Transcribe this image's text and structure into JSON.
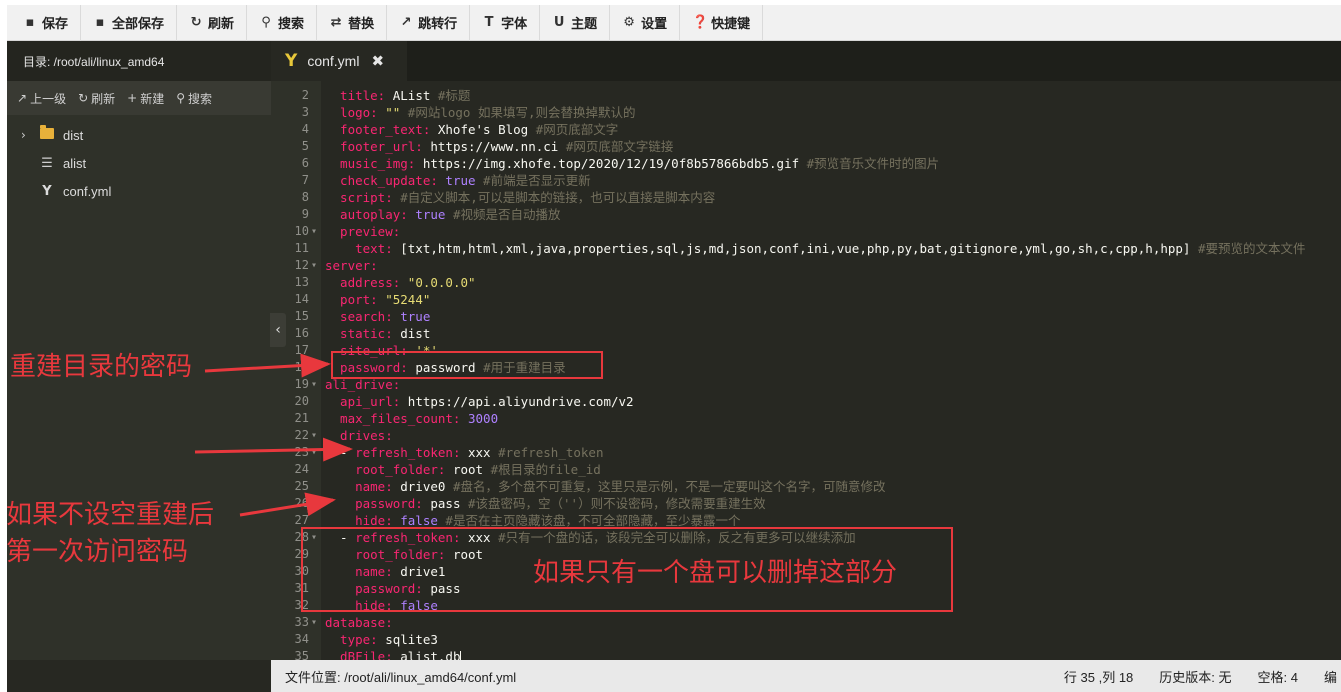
{
  "toolbar": {
    "buttons": [
      {
        "icon": "save-icon",
        "glyph": "▪",
        "label": "保存"
      },
      {
        "icon": "save-all-icon",
        "glyph": "▪",
        "label": "全部保存"
      },
      {
        "icon": "refresh-icon",
        "glyph": "↻",
        "label": "刷新"
      },
      {
        "icon": "search-icon",
        "glyph": "⚲",
        "label": "搜索"
      },
      {
        "icon": "replace-icon",
        "glyph": "⇄",
        "label": "替换"
      },
      {
        "icon": "goto-line-icon",
        "glyph": "↗",
        "label": "跳转行"
      },
      {
        "icon": "font-icon",
        "glyph": "T",
        "label": "字体"
      },
      {
        "icon": "theme-icon",
        "glyph": "U",
        "label": "主题"
      },
      {
        "icon": "gear-icon",
        "glyph": "⚙",
        "label": "设置"
      },
      {
        "icon": "shortcut-icon",
        "glyph": "❓",
        "label": "快捷键"
      }
    ]
  },
  "sidebar": {
    "path_label": "目录: /root/ali/linux_amd64",
    "actions": [
      {
        "icon": "up-arrow-icon",
        "glyph": "↗",
        "label": "上一级"
      },
      {
        "icon": "refresh-icon",
        "glyph": "↻",
        "label": "刷新"
      },
      {
        "icon": "plus-icon",
        "glyph": "+",
        "label": "新建"
      },
      {
        "icon": "search-icon",
        "glyph": "⚲",
        "label": "搜索"
      }
    ],
    "tree": [
      {
        "name": "dist",
        "type": "folder"
      },
      {
        "name": "alist",
        "type": "file"
      },
      {
        "name": "conf.yml",
        "type": "yaml"
      }
    ]
  },
  "tab": {
    "icon_text": "Y",
    "label": "conf.yml",
    "close_glyph": "✖"
  },
  "editor": {
    "lines": [
      {
        "n": "2",
        "fold": false,
        "parts": [
          [
            "k",
            "  title:"
          ],
          [
            "v",
            " AList "
          ],
          [
            "c",
            "#标题"
          ]
        ]
      },
      {
        "n": "3",
        "fold": false,
        "parts": [
          [
            "k",
            "  logo:"
          ],
          [
            "s",
            " \"\" "
          ],
          [
            "c",
            "#网站logo 如果填写,则会替换掉默认的"
          ]
        ]
      },
      {
        "n": "4",
        "fold": false,
        "parts": [
          [
            "k",
            "  footer_text:"
          ],
          [
            "v",
            " Xhofe's Blog "
          ],
          [
            "c",
            "#网页底部文字"
          ]
        ]
      },
      {
        "n": "5",
        "fold": false,
        "parts": [
          [
            "k",
            "  footer_url:"
          ],
          [
            "v",
            " https://www.nn.ci "
          ],
          [
            "c",
            "#网页底部文字链接"
          ]
        ]
      },
      {
        "n": "6",
        "fold": false,
        "parts": [
          [
            "k",
            "  music_img:"
          ],
          [
            "v",
            " https://img.xhofe.top/2020/12/19/0f8b57866bdb5.gif "
          ],
          [
            "c",
            "#预览音乐文件时的图片"
          ]
        ]
      },
      {
        "n": "7",
        "fold": false,
        "parts": [
          [
            "k",
            "  check_update:"
          ],
          [
            "n",
            " true "
          ],
          [
            "c",
            "#前端是否显示更新"
          ]
        ]
      },
      {
        "n": "8",
        "fold": false,
        "parts": [
          [
            "k",
            "  script:"
          ],
          [
            "c",
            " #自定义脚本,可以是脚本的链接，也可以直接是脚本内容"
          ]
        ]
      },
      {
        "n": "9",
        "fold": false,
        "parts": [
          [
            "k",
            "  autoplay:"
          ],
          [
            "n",
            " true "
          ],
          [
            "c",
            "#视频是否自动播放"
          ]
        ]
      },
      {
        "n": "10",
        "fold": true,
        "parts": [
          [
            "k",
            "  preview:"
          ]
        ]
      },
      {
        "n": "11",
        "fold": false,
        "parts": [
          [
            "k",
            "    text:"
          ],
          [
            "v",
            " [txt,htm,html,xml,java,properties,sql,js,md,json,conf,ini,vue,php,py,bat,gitignore,yml,go,sh,c,cpp,h,hpp] "
          ],
          [
            "c",
            "#要预览的文本文件"
          ]
        ]
      },
      {
        "n": "12",
        "fold": true,
        "parts": [
          [
            "k",
            "server:"
          ]
        ]
      },
      {
        "n": "13",
        "fold": false,
        "parts": [
          [
            "k",
            "  address:"
          ],
          [
            "s",
            " \"0.0.0.0\""
          ]
        ]
      },
      {
        "n": "14",
        "fold": false,
        "parts": [
          [
            "k",
            "  port:"
          ],
          [
            "s",
            " \"5244\""
          ]
        ]
      },
      {
        "n": "15",
        "fold": false,
        "parts": [
          [
            "k",
            "  search:"
          ],
          [
            "n",
            " true"
          ]
        ]
      },
      {
        "n": "16",
        "fold": false,
        "parts": [
          [
            "k",
            "  static:"
          ],
          [
            "v",
            " dist"
          ]
        ]
      },
      {
        "n": "17",
        "fold": false,
        "parts": [
          [
            "k",
            "  site_url:"
          ],
          [
            "s",
            " '*'"
          ]
        ]
      },
      {
        "n": "18",
        "fold": false,
        "parts": [
          [
            "k",
            "  password:"
          ],
          [
            "v",
            " password "
          ],
          [
            "c",
            "#用于重建目录"
          ]
        ]
      },
      {
        "n": "19",
        "fold": true,
        "parts": [
          [
            "k",
            "ali_drive:"
          ]
        ]
      },
      {
        "n": "20",
        "fold": false,
        "parts": [
          [
            "k",
            "  api_url:"
          ],
          [
            "v",
            " https://api.aliyundrive.com/v2"
          ]
        ]
      },
      {
        "n": "21",
        "fold": false,
        "parts": [
          [
            "k",
            "  max_files_count:"
          ],
          [
            "n",
            " 3000"
          ]
        ]
      },
      {
        "n": "22",
        "fold": true,
        "parts": [
          [
            "k",
            "  drives:"
          ]
        ]
      },
      {
        "n": "23",
        "fold": true,
        "parts": [
          [
            "v",
            "  - "
          ],
          [
            "k",
            "refresh_token:"
          ],
          [
            "v",
            " xxx "
          ],
          [
            "c",
            "#refresh_token"
          ]
        ]
      },
      {
        "n": "24",
        "fold": false,
        "parts": [
          [
            "k",
            "    root_folder:"
          ],
          [
            "v",
            " root "
          ],
          [
            "c",
            "#根目录的file_id"
          ]
        ]
      },
      {
        "n": "25",
        "fold": false,
        "parts": [
          [
            "k",
            "    name:"
          ],
          [
            "v",
            " drive0 "
          ],
          [
            "c",
            "#盘名，多个盘不可重复，这里只是示例，不是一定要叫这个名字，可随意修改"
          ]
        ]
      },
      {
        "n": "26",
        "fold": false,
        "parts": [
          [
            "k",
            "    password:"
          ],
          [
            "v",
            " pass "
          ],
          [
            "c",
            "#该盘密码，空（''）则不设密码，修改需要重建生效"
          ]
        ]
      },
      {
        "n": "27",
        "fold": false,
        "parts": [
          [
            "k",
            "    hide:"
          ],
          [
            "n",
            " false "
          ],
          [
            "c",
            "#是否在主页隐藏该盘，不可全部隐藏，至少暴露一个"
          ]
        ]
      },
      {
        "n": "28",
        "fold": true,
        "parts": [
          [
            "v",
            "  - "
          ],
          [
            "k",
            "refresh_token:"
          ],
          [
            "v",
            " xxx "
          ],
          [
            "c",
            "#只有一个盘的话，该段完全可以删除，反之有更多可以继续添加"
          ]
        ]
      },
      {
        "n": "29",
        "fold": false,
        "parts": [
          [
            "k",
            "    root_folder:"
          ],
          [
            "v",
            " root"
          ]
        ]
      },
      {
        "n": "30",
        "fold": false,
        "parts": [
          [
            "k",
            "    name:"
          ],
          [
            "v",
            " drive1"
          ]
        ]
      },
      {
        "n": "31",
        "fold": false,
        "parts": [
          [
            "k",
            "    password:"
          ],
          [
            "v",
            " pass"
          ]
        ]
      },
      {
        "n": "32",
        "fold": false,
        "parts": [
          [
            "k",
            "    hide:"
          ],
          [
            "n",
            " false"
          ]
        ]
      },
      {
        "n": "33",
        "fold": true,
        "parts": [
          [
            "k",
            "database:"
          ]
        ]
      },
      {
        "n": "34",
        "fold": false,
        "parts": [
          [
            "k",
            "  type:"
          ],
          [
            "v",
            " sqlite3"
          ]
        ]
      },
      {
        "n": "35",
        "fold": false,
        "parts": [
          [
            "k",
            "  dBFile:"
          ],
          [
            "v",
            " alist.db"
          ]
        ],
        "cursor": true
      }
    ]
  },
  "status": {
    "file_path": "文件位置:  /root/ali/linux_amd64/conf.yml",
    "position": "行 35 ,列 18",
    "history": "历史版本: 无",
    "indent": "空格: 4",
    "encoding": "编"
  },
  "annotations": {
    "rebuild_password": "重建目录的密码",
    "first_visit_line1": "如果不设空重建后",
    "first_visit_line2": "第一次访问密码",
    "delete_section": "如果只有一个盘可以删掉这部分"
  },
  "colors": {
    "editor_bg": "#272822",
    "sidebar_bg": "#2f3129",
    "keyword": "#f92672",
    "string": "#e6db74",
    "number": "#ae81ff",
    "comment": "#75715e",
    "annotation_red": "#e8383d"
  }
}
